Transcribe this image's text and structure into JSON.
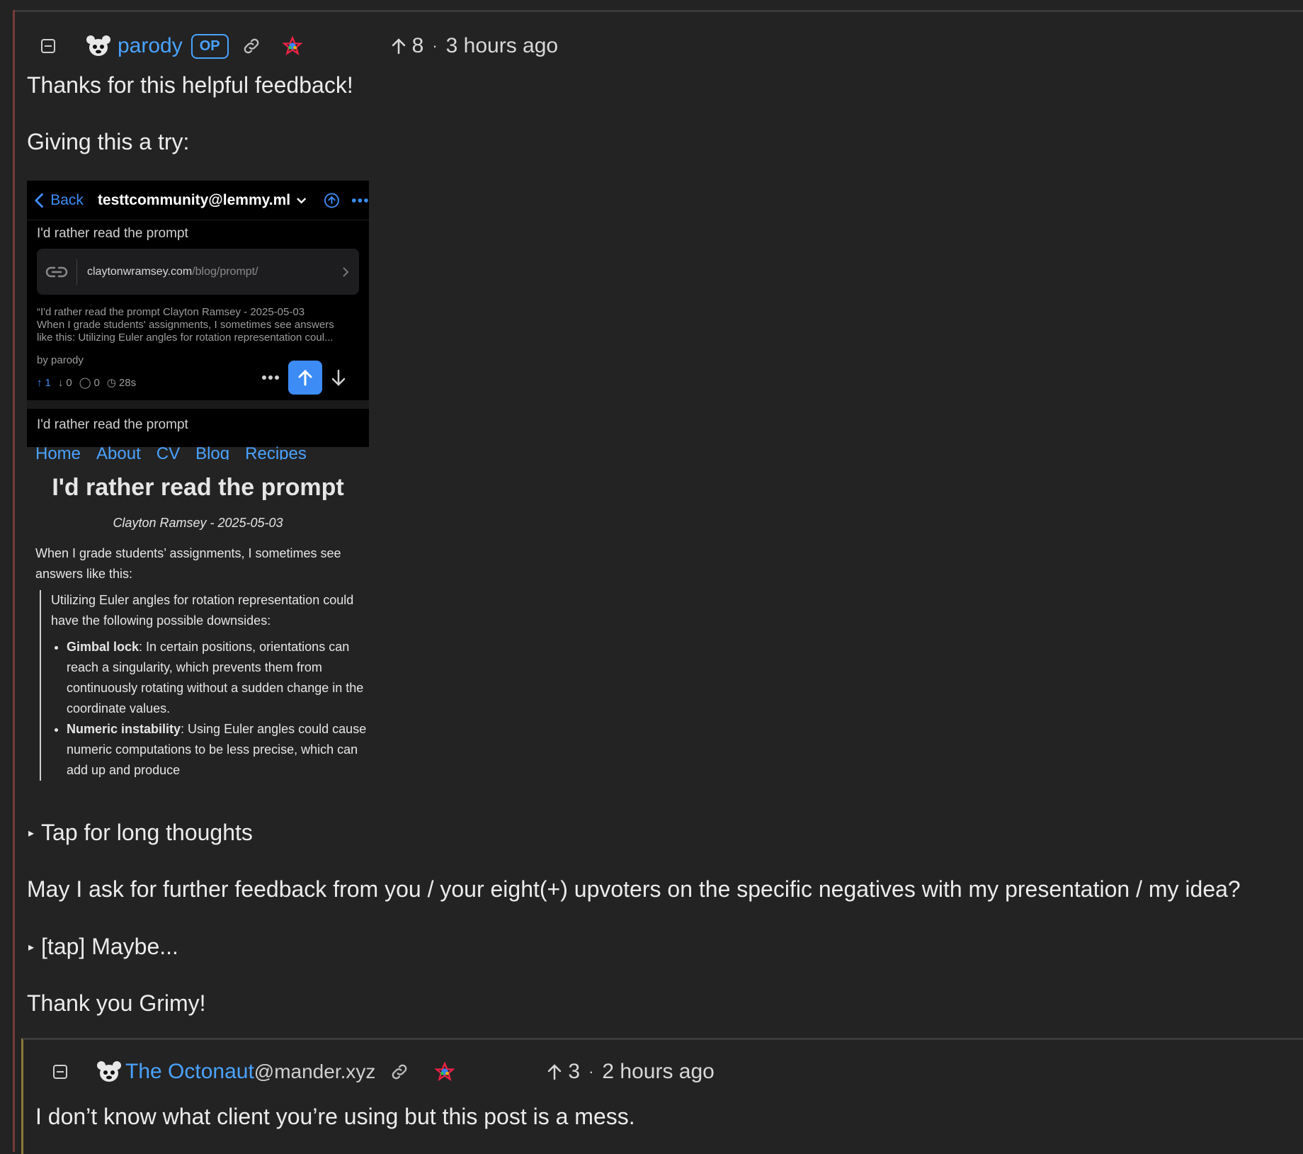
{
  "comment1": {
    "username": "parody",
    "op_badge": "OP",
    "score": "8",
    "separator": "·",
    "time": "3 hours ago",
    "p1": "Thanks for this helpful feedback!",
    "p2": "Giving this a try:",
    "details1": "Tap for long thoughts",
    "p3": "May I ask for further feedback from you / your eight(+) upvoters on the specific negatives with my presentation / my idea?",
    "details2": "[tap] Maybe...",
    "p4": "Thank you Grimy!"
  },
  "embed": {
    "back": "Back",
    "community": "testtcommunity@lemmy.ml",
    "post_title": "I'd rather read the prompt",
    "link_domain": "claytonwramsey.com",
    "link_path": "/blog/prompt/",
    "excerpt_l1": "“I'd rather read the prompt  Clayton Ramsey - 2025-05-03",
    "excerpt_l2": "When I grade students' assignments, I sometimes see answers",
    "excerpt_l3": "like this: Utilizing Euler angles for rotation representation coul...",
    "byline": "by parody",
    "up": "1",
    "down": "0",
    "comments": "0",
    "age": "28s",
    "next_title": "I'd rather read the prompt"
  },
  "article": {
    "nav": [
      "Home",
      "About",
      "CV",
      "Blog",
      "Recipes"
    ],
    "title": "I'd rather read the prompt",
    "byline": "Clayton Ramsey - 2025-05-03",
    "intro": "When I grade students’ assignments, I sometimes see answers like this:",
    "quote_intro": "Utilizing Euler angles for rotation representation could have the following possible downsides:",
    "b1_bold": "Gimbal lock",
    "b1_rest": ": In certain positions, orientations can reach a singularity, which prevents them from continuously rotating without a sudden change in the coordinate values.",
    "b2_bold": "Numeric instability",
    "b2_rest": ": Using Euler angles could cause numeric computations to be less precise, which can add up and produce"
  },
  "comment2": {
    "username": "The Octonaut",
    "instance": "@mander.xyz",
    "score": "3",
    "separator": "·",
    "time": "2 hours ago",
    "body": "I don’t know what client you’re using but this post is a mess."
  },
  "colors": {
    "accent": "#4aa3ff",
    "background": "#232323",
    "thread_rule": "#7a3a3a"
  }
}
